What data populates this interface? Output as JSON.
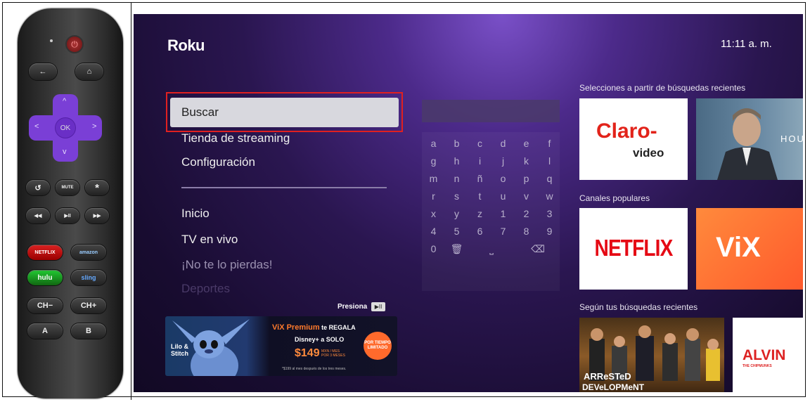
{
  "remote": {
    "buttons": {
      "back": "←",
      "home": "⌂",
      "ok": "OK",
      "up": "^",
      "down": "v",
      "left": "<",
      "right": ">",
      "replay": "↺",
      "mute": "MUTE",
      "options": "*",
      "rewind": "◀◀",
      "play_pause": "▶II",
      "forward": "▶▶",
      "netflix": "NETFLIX",
      "amazon": "amazon",
      "hulu": "hulu",
      "sling": "sling",
      "ch_down": "CH−",
      "ch_up": "CH+",
      "a": "A",
      "b": "B"
    },
    "colors": {
      "dpad": "#7a3fd6",
      "power": "#a33333"
    }
  },
  "tv": {
    "logo": "Roku",
    "clock": "11:11 a. m.",
    "menu": {
      "selected": "Buscar",
      "items_top": [
        "Tienda de streaming",
        "Configuración"
      ],
      "items_bottom": [
        "Inicio",
        "TV en vivo",
        "¡No te lo pierdas!",
        "Deportes"
      ]
    },
    "keyboard": {
      "rows": [
        [
          "a",
          "b",
          "c",
          "d",
          "e",
          "f"
        ],
        [
          "g",
          "h",
          "i",
          "j",
          "k",
          "l"
        ],
        [
          "m",
          "n",
          "ñ",
          "o",
          "p",
          "q"
        ],
        [
          "r",
          "s",
          "t",
          "u",
          "v",
          "w"
        ],
        [
          "x",
          "y",
          "z",
          "1",
          "2",
          "3"
        ],
        [
          "4",
          "5",
          "6",
          "7",
          "8",
          "9"
        ]
      ],
      "last_row": {
        "zero": "0",
        "delete_all": "🗑",
        "space": "⎵",
        "backspace": "⌫"
      }
    },
    "sections": {
      "recent_picks": "Selecciones a partir de búsquedas recientes",
      "popular": "Canales populares",
      "based_on_searches": "Según tus búsquedas recientes"
    },
    "tiles": {
      "claro_title": "Claro-",
      "claro_sub": "video",
      "house_text": "HOU",
      "netflix": "NETFLIX",
      "vix": "ViX",
      "arrested_top": "ARReSTeD",
      "arrested_bottom": "DEVeLOPMeNT",
      "alvin": "ALVIN",
      "alvin_sub": "THE CHIPMUNKS"
    },
    "promo": {
      "presiona": "Presiona",
      "play_icon": "▶II",
      "stitch_title": "Lilo & Stitch",
      "headline_brand": "ViX Premium",
      "headline_rest": " te REGALA",
      "line2": "Disney+ a SOLO",
      "price": "$149",
      "price_note": "MXN / MES POR 3 MESES",
      "badge": "POR TIEMPO LIMITADO",
      "fineprint": "*$199 al mes después de los tres meses."
    },
    "colors": {
      "highlight_border": "#e02020",
      "netflix_red": "#e50914",
      "vix_orange": "#ff6a2c",
      "claro_red": "#e2231a"
    }
  }
}
